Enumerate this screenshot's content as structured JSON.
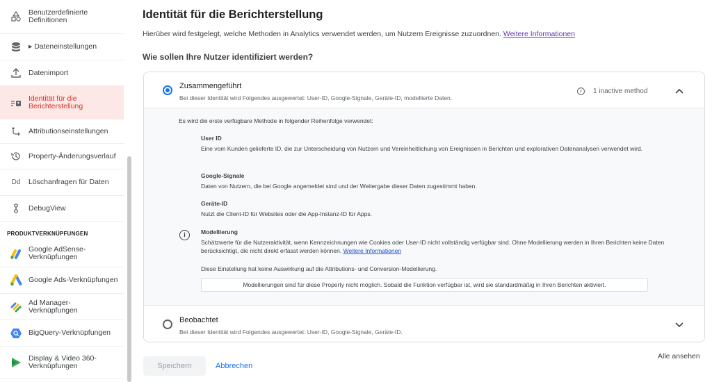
{
  "sidebar": {
    "items": [
      {
        "label": "Benutzerdefinierte Definitionen"
      },
      {
        "label": "▸ Dateneinstellungen"
      },
      {
        "label": "Datenimport"
      },
      {
        "label": "Identität für die Berichterstellung"
      },
      {
        "label": "Attributionseinstellungen"
      },
      {
        "label": "Property-Änderungsverlauf"
      },
      {
        "label": "Löschanfragen für Daten"
      },
      {
        "label": "DebugView"
      },
      {
        "label": "Google AdSense-Verknüpfungen"
      },
      {
        "label": "Google Ads-Verknüpfungen"
      },
      {
        "label": "Ad Manager-Verknüpfungen"
      },
      {
        "label": "BigQuery-Verknüpfungen"
      },
      {
        "label": "Display & Video 360-Verknüpfungen"
      }
    ],
    "section_label": "PRODUKTVERKNÜPFUNGEN",
    "dd_icon_text": "Dd"
  },
  "page": {
    "title": "Identität für die Berichterstellung",
    "subtitle": "Hierüber wird festgelegt, welche Methoden in Analytics verwendet werden, um Nutzern Ereignisse zuzuordnen.",
    "subtitle_link": "Weitere Informationen",
    "question": "Wie sollen Ihre Nutzer identifiziert werden?"
  },
  "options": {
    "blended": {
      "title": "Zusammengeführt",
      "desc": "Bei dieser Identität wird Folgendes ausgewertet: User-ID, Google-Signale, Geräte-ID, modellierte Daten.",
      "inactive": "1 inactive method",
      "intro": "Es wird die erste verfügbare Methode in folgender Reihenfolge verwendet:",
      "methods": [
        {
          "title": "User ID",
          "desc": "Eine vom Kunden gelieferte ID, die zur Unterscheidung von Nutzern und Vereinheitlichung von Ereignissen in Berichten und explorativen Datenanalysen verwendet wird."
        },
        {
          "title": "Google-Signale",
          "desc": "Daten von Nutzern, die bei Google angemeldet sind und der Weitergabe dieser Daten zugestimmt haben."
        },
        {
          "title": "Geräte-ID",
          "desc": "Nutzt die Client-ID für Websites oder die App-Instanz-ID für Apps."
        },
        {
          "title": "Modellierung",
          "desc": "Schätzwerte für die Nutzeraktivität, wenn Kennzeichnungen wie Cookies oder User-ID nicht vollständig verfügbar sind. Ohne Modellierung werden in Ihren Berichten keine Daten berücksichtigt, die nicht direkt erfasst werden können.",
          "link": "Weitere Informationen"
        }
      ],
      "attribution_note": "Diese Einstellung hat keine Auswirkung auf die Attributions- und Conversion-Modellierung.",
      "box_note": "Modellierungen sind für diese Property nicht möglich. Sobald die Funktion verfügbar ist, wird sie standardmäßig in Ihren Berichten aktiviert."
    },
    "observed": {
      "title": "Beobachtet",
      "desc": "Bei dieser Identität wird Folgendes ausgewertet: User-ID, Google-Signale, Geräte-ID."
    }
  },
  "footer": {
    "save": "Speichern",
    "cancel": "Abbrechen",
    "see_all": "Alle ansehen"
  },
  "colors": {
    "accent": "#1a73e8",
    "active_bg": "#fce8e6",
    "active_text": "#d93025"
  }
}
